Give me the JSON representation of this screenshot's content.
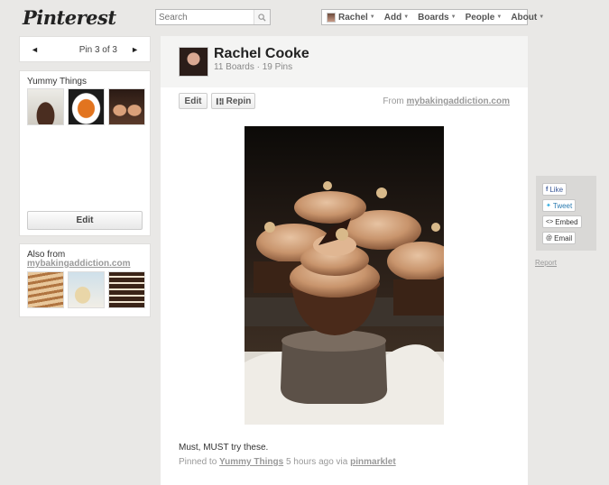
{
  "header": {
    "logo": "Pinterest",
    "search_placeholder": "Search",
    "nav": {
      "user": "Rachel",
      "add": "Add",
      "boards": "Boards",
      "people": "People",
      "about": "About"
    }
  },
  "pager": {
    "prev_symbol": "◄",
    "next_symbol": "►",
    "count": "Pin 3 of 3"
  },
  "board": {
    "title": "Yummy Things",
    "edit_label": "Edit"
  },
  "also_from": {
    "title": "Also from",
    "domain": "mybakingaddiction.com"
  },
  "pin": {
    "user_name": "Rachel Cooke",
    "boards_count": "11 Boards",
    "separator": "·",
    "pins_count": "19 Pins",
    "edit_label": "Edit",
    "repin_label": "Repin",
    "from_label": "From",
    "from_domain": "mybakingaddiction.com",
    "description": "Must, MUST try these.",
    "pinned_to_label": "Pinned to",
    "board_name": "Yummy Things",
    "time_ago": "5 hours ago via",
    "via": "pinmarklet"
  },
  "share": {
    "like": "Like",
    "tweet": "Tweet",
    "embed": "Embed",
    "email": "Email",
    "report": "Report"
  }
}
